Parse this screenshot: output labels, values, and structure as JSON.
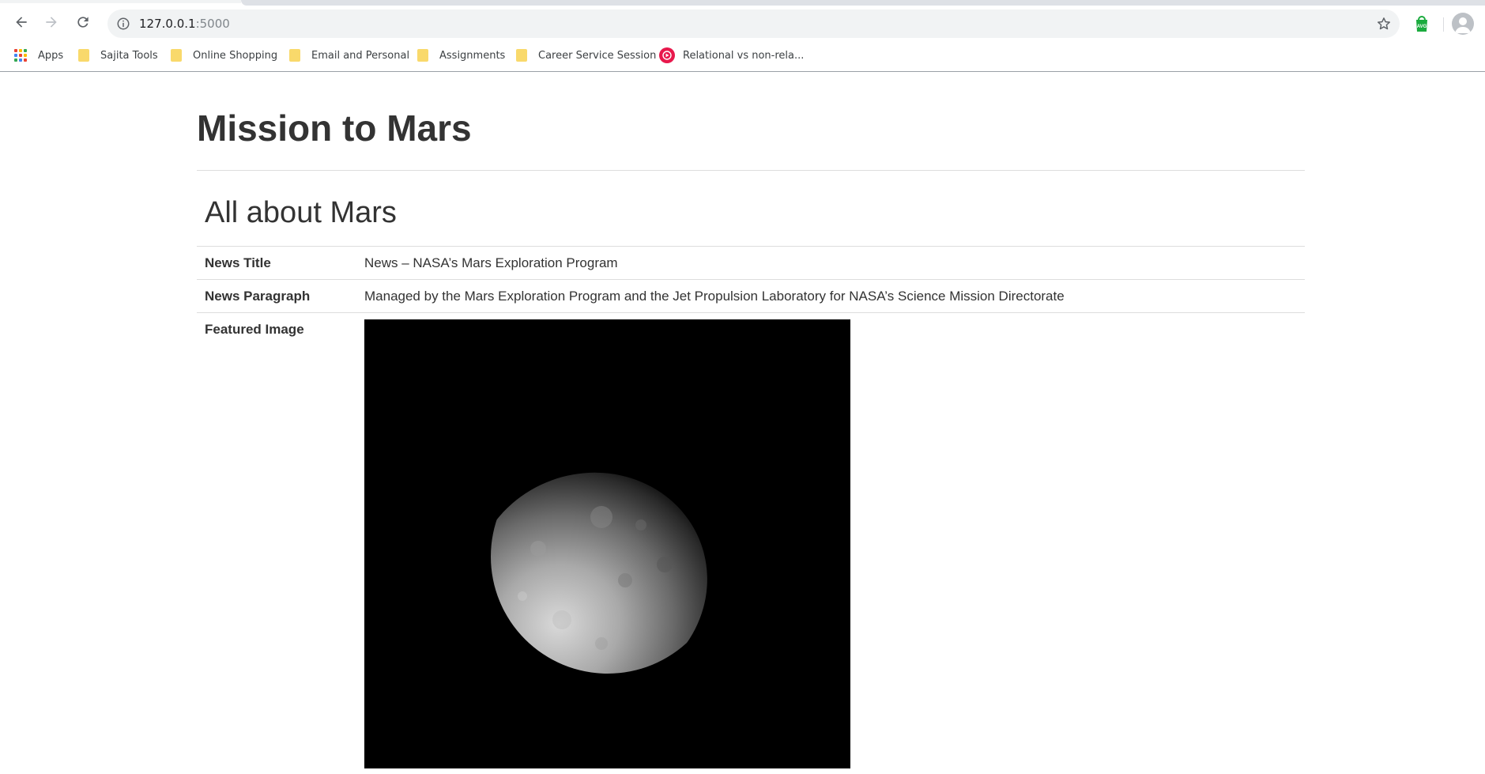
{
  "browser": {
    "url_host": "127.0.0.1",
    "url_port": ":5000",
    "bookmarks": [
      {
        "label": "Apps",
        "icon": "apps-grid-icon"
      },
      {
        "label": "Sajita Tools",
        "icon": "folder-icon"
      },
      {
        "label": "Online Shopping",
        "icon": "folder-icon"
      },
      {
        "label": "Email and Personal",
        "icon": "folder-icon"
      },
      {
        "label": "Assignments",
        "icon": "folder-icon"
      },
      {
        "label": "Career Service Session",
        "icon": "folder-icon"
      },
      {
        "label": "Relational vs non-rela...",
        "icon": "video-play-icon"
      }
    ],
    "extension_label": "AVG",
    "colors": {
      "folder": "#f9d96b",
      "extension": "#1bab3e",
      "video_icon": "#e8184c"
    }
  },
  "page": {
    "title": "Mission to Mars",
    "section_title": "All about Mars",
    "rows": [
      {
        "label": "News Title",
        "value": "News – NASA’s Mars Exploration Program"
      },
      {
        "label": "News Paragraph",
        "value": "Managed by the Mars Exploration Program and the Jet Propulsion Laboratory for NASA’s Science Mission Directorate"
      },
      {
        "label": "Featured Image",
        "image": "moon-crescent-grayscale-photo"
      }
    ]
  }
}
